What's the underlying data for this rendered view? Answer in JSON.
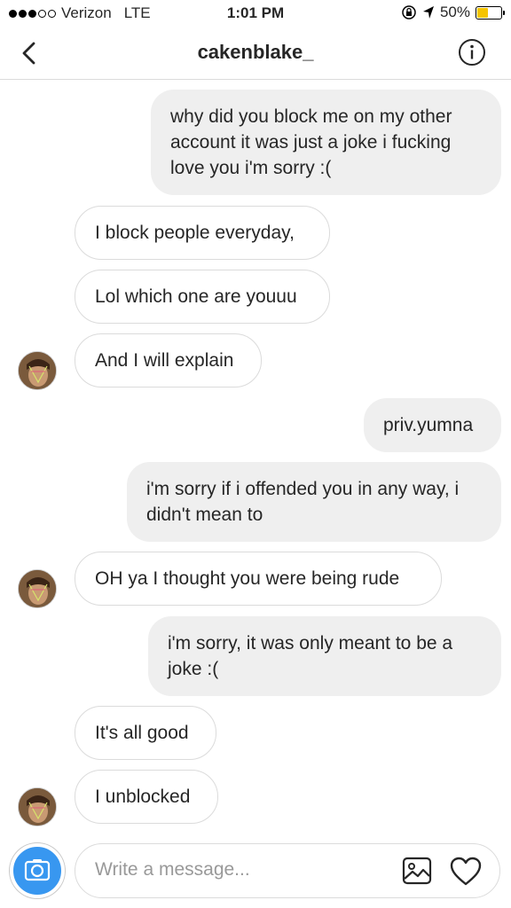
{
  "status_bar": {
    "carrier": "Verizon",
    "network": "LTE",
    "time": "1:01 PM",
    "battery": "50%",
    "battery_level": 0.5,
    "signal_bars": 3,
    "signal_total": 5
  },
  "header": {
    "title": "cakenblake_",
    "back_icon": "chevron-left-icon",
    "info_icon": "info-icon"
  },
  "messages": [
    {
      "from": "me",
      "text": "why did you block me on my other account it was just a joke i fucking love you i'm sorry :("
    },
    {
      "from": "them",
      "text": "I block people everyday,"
    },
    {
      "from": "them",
      "text": "Lol which one are youuu"
    },
    {
      "from": "them",
      "text": "And I will explain"
    },
    {
      "from": "me",
      "text": "priv.yumna"
    },
    {
      "from": "me",
      "text": "i'm sorry if i offended you in any way, i didn't mean to"
    },
    {
      "from": "them",
      "text": "OH ya I thought you were being rude"
    },
    {
      "from": "me",
      "text": "i'm sorry, it was only meant to be a joke :("
    },
    {
      "from": "them",
      "text": "It's all good"
    },
    {
      "from": "them",
      "text": "I unblocked"
    }
  ],
  "composer": {
    "placeholder": "Write a message...",
    "camera_icon": "camera-icon",
    "gallery_icon": "gallery-icon",
    "heart_icon": "heart-icon"
  },
  "colors": {
    "accent": "#3897f0",
    "outgoing_bubble": "#efefef",
    "border": "#dbdbdb",
    "battery": "#f5c400"
  }
}
